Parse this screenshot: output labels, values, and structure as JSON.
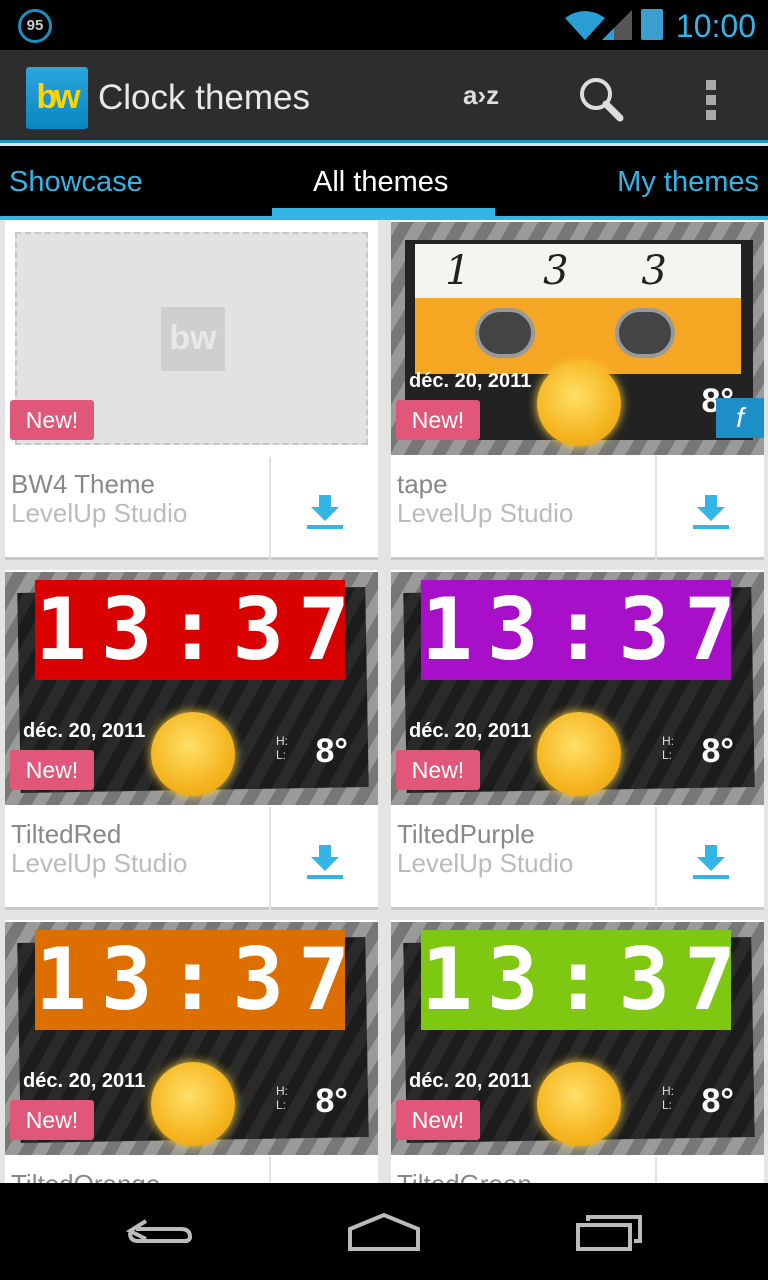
{
  "status_bar": {
    "battery_circle": "95",
    "time": "10:00"
  },
  "action_bar": {
    "logo": "bw",
    "title": "Clock themes",
    "sort_label": "a›z"
  },
  "tabs": [
    {
      "label": "Showcase"
    },
    {
      "label": "All themes",
      "active": true
    },
    {
      "label": "My themes"
    }
  ],
  "themes": [
    {
      "name": "BW4 Theme",
      "author": "LevelUp Studio",
      "badge": "New!",
      "style": "placeholder"
    },
    {
      "name": "tape",
      "author": "LevelUp Studio",
      "badge": "New!",
      "style": "tape",
      "clock": "1 3 3 7",
      "date": "déc. 20, 2011",
      "temp": "8°"
    },
    {
      "name": "TiltedRed",
      "author": "LevelUp Studio",
      "badge": "New!",
      "color": "#d90000",
      "clock": "13:37",
      "date": "déc. 20, 2011",
      "temp": "8°"
    },
    {
      "name": "TiltedPurple",
      "author": "LevelUp Studio",
      "badge": "New!",
      "color": "#a80fc8",
      "clock": "13:37",
      "date": "déc. 20, 2011",
      "temp": "8°"
    },
    {
      "name": "TiltedOrange",
      "author": "LevelUp Studio",
      "badge": "New!",
      "color": "#dd6f00",
      "clock": "13:37",
      "date": "déc. 20, 2011",
      "temp": "8°"
    },
    {
      "name": "TiltedGreen",
      "author": "LevelUp Studio",
      "badge": "New!",
      "color": "#7ec811",
      "clock": "13:37",
      "date": "déc. 20, 2011",
      "temp": "8°"
    }
  ],
  "colors": {
    "accent": "#33b5e5",
    "badge": "#e0577a"
  }
}
